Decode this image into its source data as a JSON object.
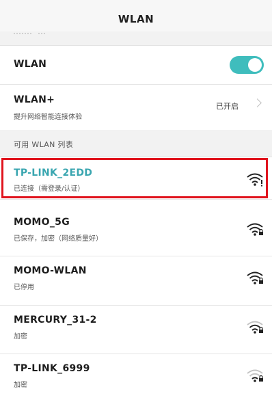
{
  "header": {
    "title": "WLAN"
  },
  "settings": {
    "wlan": {
      "label": "WLAN",
      "enabled": true
    },
    "wlan_plus": {
      "label": "WLAN+",
      "description": "提升网络智能连接体验",
      "status": "已开启"
    }
  },
  "available_section": {
    "title": "可用 WLAN 列表"
  },
  "networks": [
    {
      "ssid": "TP-LINK_2EDD",
      "status": "已连接（需登录/认证）",
      "signal": "strong",
      "secured": false,
      "selected": true
    },
    {
      "ssid": "MOMO_5G",
      "status": "已保存，加密（网络质量好）",
      "signal": "strong",
      "secured": true
    },
    {
      "ssid": "MOMO-WLAN",
      "status": "已停用",
      "signal": "strong",
      "secured": true
    },
    {
      "ssid": "MERCURY_31-2",
      "status": "加密",
      "signal": "medium",
      "secured": true
    },
    {
      "ssid": "TP-LINK_6999",
      "status": "加密",
      "signal": "weak",
      "secured": true
    }
  ],
  "colors": {
    "accent": "#3fbdbd",
    "selected_text": "#3aa6b0",
    "highlight_border": "#e0141e"
  },
  "icons": {
    "wifi": "wifi-signal-icon",
    "lock": "lock-icon",
    "chevron": "chevron-right-icon"
  }
}
